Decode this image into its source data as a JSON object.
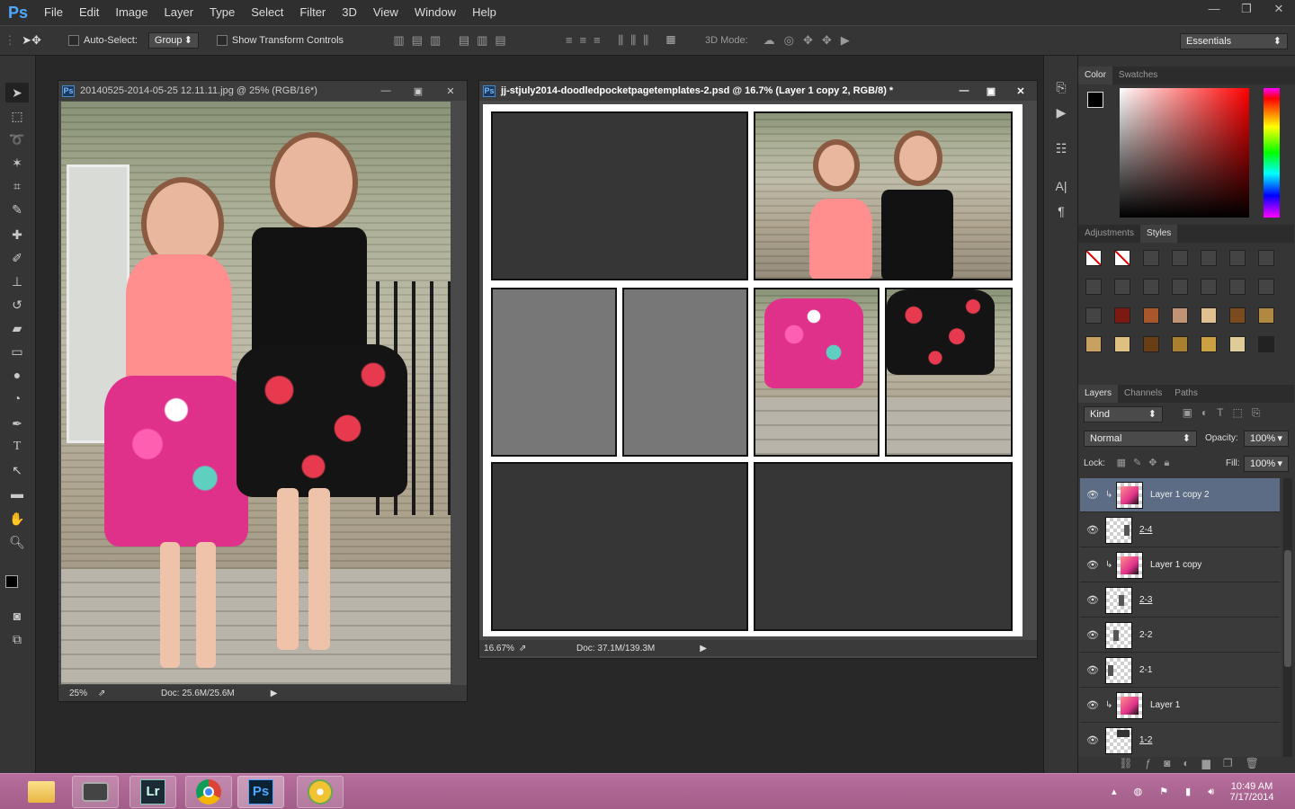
{
  "app": {
    "logo": "Ps"
  },
  "menu": [
    "File",
    "Edit",
    "Image",
    "Layer",
    "Type",
    "Select",
    "Filter",
    "3D",
    "View",
    "Window",
    "Help"
  ],
  "window_controls": [
    "—",
    "❐",
    "✕"
  ],
  "options": {
    "auto_select_label": "Auto-Select:",
    "auto_select_value": "Group",
    "transform_label": "Show Transform Controls",
    "mode_label": "3D Mode:",
    "workspace": "Essentials"
  },
  "doc1": {
    "title": "20140525-2014-05-25 12.11.11.jpg @ 25% (RGB/16*)",
    "zoom": "25%",
    "doc_size": "Doc: 25.6M/25.6M"
  },
  "doc2": {
    "title": "jj-stjuly2014-doodledpocketpagetemplates-2.psd @ 16.7% (Layer 1 copy 2, RGB/8) *",
    "zoom": "16.67%",
    "doc_size": "Doc: 37.1M/139.3M"
  },
  "color_panel": {
    "tabs": [
      "Color",
      "Swatches"
    ]
  },
  "styles_panel": {
    "tabs": [
      "Adjustments",
      "Styles"
    ]
  },
  "layers_panel": {
    "tabs": [
      "Layers",
      "Channels",
      "Paths"
    ],
    "filter": "Kind",
    "blend_mode": "Normal",
    "opacity_label": "Opacity:",
    "opacity": "100%",
    "lock_label": "Lock:",
    "fill_label": "Fill:",
    "fill": "100%",
    "layers": [
      {
        "name": "Layer 1 copy 2",
        "selected": true,
        "clipped": true,
        "photo": true
      },
      {
        "name": "2-4",
        "selected": false,
        "clipped": false,
        "photo": false
      },
      {
        "name": "Layer 1 copy",
        "selected": false,
        "clipped": true,
        "photo": true
      },
      {
        "name": "2-3",
        "selected": false,
        "clipped": false,
        "photo": false
      },
      {
        "name": "2-2",
        "selected": false,
        "clipped": false,
        "photo": false
      },
      {
        "name": "2-1",
        "selected": false,
        "clipped": false,
        "photo": false
      },
      {
        "name": "Layer 1",
        "selected": false,
        "clipped": true,
        "photo": true
      },
      {
        "name": "1-2",
        "selected": false,
        "clipped": false,
        "photo": false
      }
    ]
  },
  "taskbar": {
    "time": "10:49 AM",
    "date": "7/17/2014",
    "apps": [
      "file-explorer",
      "camera",
      "Lr",
      "chrome",
      "Ps",
      "cd-burner"
    ]
  },
  "colors": {
    "accent": "#4fa8ff",
    "selected_layer": "#5b6c84",
    "taskbar": "#a25d89"
  }
}
